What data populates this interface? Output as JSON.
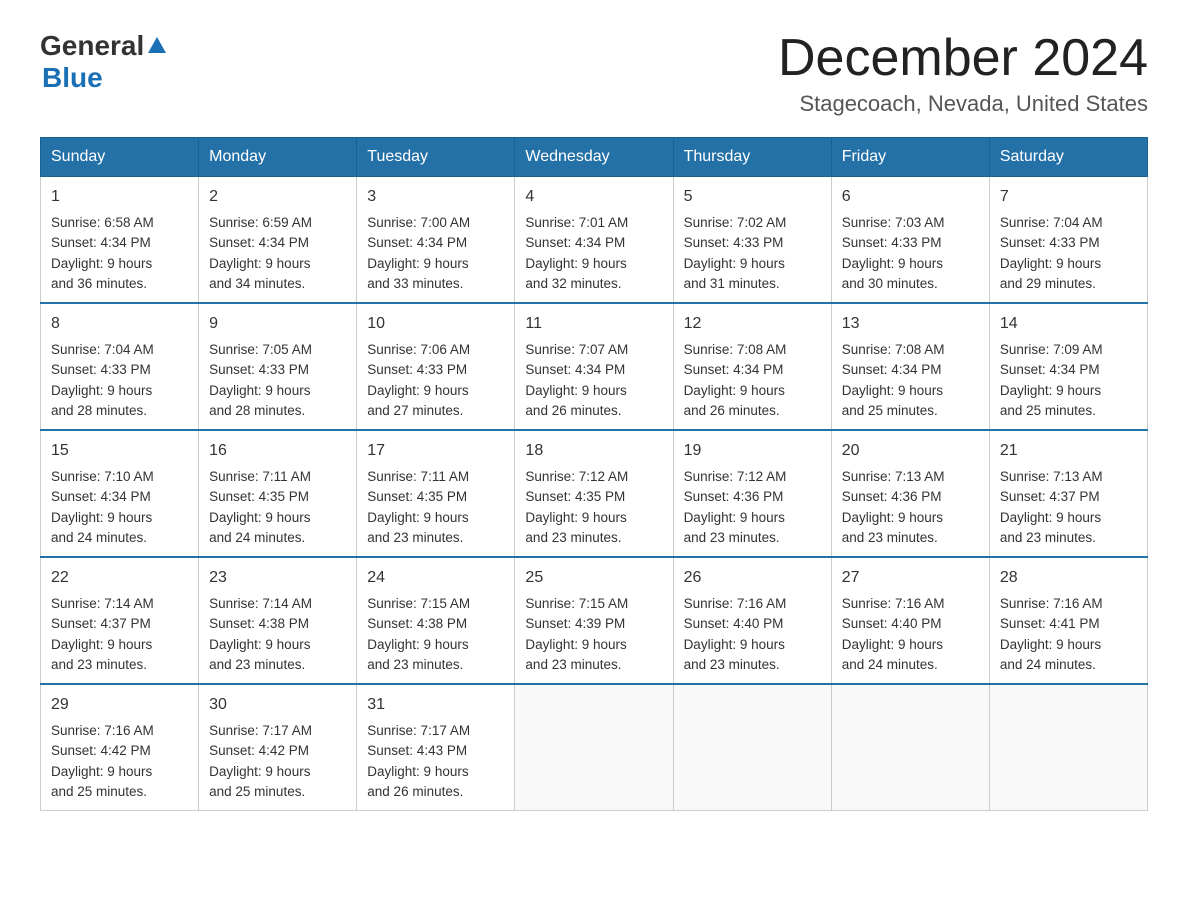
{
  "header": {
    "logo": {
      "line1": "General",
      "line2": "Blue"
    },
    "title": "December 2024",
    "location": "Stagecoach, Nevada, United States"
  },
  "weekdays": [
    "Sunday",
    "Monday",
    "Tuesday",
    "Wednesday",
    "Thursday",
    "Friday",
    "Saturday"
  ],
  "weeks": [
    [
      {
        "day": "1",
        "sunrise": "Sunrise: 6:58 AM",
        "sunset": "Sunset: 4:34 PM",
        "daylight": "Daylight: 9 hours",
        "daylight2": "and 36 minutes."
      },
      {
        "day": "2",
        "sunrise": "Sunrise: 6:59 AM",
        "sunset": "Sunset: 4:34 PM",
        "daylight": "Daylight: 9 hours",
        "daylight2": "and 34 minutes."
      },
      {
        "day": "3",
        "sunrise": "Sunrise: 7:00 AM",
        "sunset": "Sunset: 4:34 PM",
        "daylight": "Daylight: 9 hours",
        "daylight2": "and 33 minutes."
      },
      {
        "day": "4",
        "sunrise": "Sunrise: 7:01 AM",
        "sunset": "Sunset: 4:34 PM",
        "daylight": "Daylight: 9 hours",
        "daylight2": "and 32 minutes."
      },
      {
        "day": "5",
        "sunrise": "Sunrise: 7:02 AM",
        "sunset": "Sunset: 4:33 PM",
        "daylight": "Daylight: 9 hours",
        "daylight2": "and 31 minutes."
      },
      {
        "day": "6",
        "sunrise": "Sunrise: 7:03 AM",
        "sunset": "Sunset: 4:33 PM",
        "daylight": "Daylight: 9 hours",
        "daylight2": "and 30 minutes."
      },
      {
        "day": "7",
        "sunrise": "Sunrise: 7:04 AM",
        "sunset": "Sunset: 4:33 PM",
        "daylight": "Daylight: 9 hours",
        "daylight2": "and 29 minutes."
      }
    ],
    [
      {
        "day": "8",
        "sunrise": "Sunrise: 7:04 AM",
        "sunset": "Sunset: 4:33 PM",
        "daylight": "Daylight: 9 hours",
        "daylight2": "and 28 minutes."
      },
      {
        "day": "9",
        "sunrise": "Sunrise: 7:05 AM",
        "sunset": "Sunset: 4:33 PM",
        "daylight": "Daylight: 9 hours",
        "daylight2": "and 28 minutes."
      },
      {
        "day": "10",
        "sunrise": "Sunrise: 7:06 AM",
        "sunset": "Sunset: 4:33 PM",
        "daylight": "Daylight: 9 hours",
        "daylight2": "and 27 minutes."
      },
      {
        "day": "11",
        "sunrise": "Sunrise: 7:07 AM",
        "sunset": "Sunset: 4:34 PM",
        "daylight": "Daylight: 9 hours",
        "daylight2": "and 26 minutes."
      },
      {
        "day": "12",
        "sunrise": "Sunrise: 7:08 AM",
        "sunset": "Sunset: 4:34 PM",
        "daylight": "Daylight: 9 hours",
        "daylight2": "and 26 minutes."
      },
      {
        "day": "13",
        "sunrise": "Sunrise: 7:08 AM",
        "sunset": "Sunset: 4:34 PM",
        "daylight": "Daylight: 9 hours",
        "daylight2": "and 25 minutes."
      },
      {
        "day": "14",
        "sunrise": "Sunrise: 7:09 AM",
        "sunset": "Sunset: 4:34 PM",
        "daylight": "Daylight: 9 hours",
        "daylight2": "and 25 minutes."
      }
    ],
    [
      {
        "day": "15",
        "sunrise": "Sunrise: 7:10 AM",
        "sunset": "Sunset: 4:34 PM",
        "daylight": "Daylight: 9 hours",
        "daylight2": "and 24 minutes."
      },
      {
        "day": "16",
        "sunrise": "Sunrise: 7:11 AM",
        "sunset": "Sunset: 4:35 PM",
        "daylight": "Daylight: 9 hours",
        "daylight2": "and 24 minutes."
      },
      {
        "day": "17",
        "sunrise": "Sunrise: 7:11 AM",
        "sunset": "Sunset: 4:35 PM",
        "daylight": "Daylight: 9 hours",
        "daylight2": "and 23 minutes."
      },
      {
        "day": "18",
        "sunrise": "Sunrise: 7:12 AM",
        "sunset": "Sunset: 4:35 PM",
        "daylight": "Daylight: 9 hours",
        "daylight2": "and 23 minutes."
      },
      {
        "day": "19",
        "sunrise": "Sunrise: 7:12 AM",
        "sunset": "Sunset: 4:36 PM",
        "daylight": "Daylight: 9 hours",
        "daylight2": "and 23 minutes."
      },
      {
        "day": "20",
        "sunrise": "Sunrise: 7:13 AM",
        "sunset": "Sunset: 4:36 PM",
        "daylight": "Daylight: 9 hours",
        "daylight2": "and 23 minutes."
      },
      {
        "day": "21",
        "sunrise": "Sunrise: 7:13 AM",
        "sunset": "Sunset: 4:37 PM",
        "daylight": "Daylight: 9 hours",
        "daylight2": "and 23 minutes."
      }
    ],
    [
      {
        "day": "22",
        "sunrise": "Sunrise: 7:14 AM",
        "sunset": "Sunset: 4:37 PM",
        "daylight": "Daylight: 9 hours",
        "daylight2": "and 23 minutes."
      },
      {
        "day": "23",
        "sunrise": "Sunrise: 7:14 AM",
        "sunset": "Sunset: 4:38 PM",
        "daylight": "Daylight: 9 hours",
        "daylight2": "and 23 minutes."
      },
      {
        "day": "24",
        "sunrise": "Sunrise: 7:15 AM",
        "sunset": "Sunset: 4:38 PM",
        "daylight": "Daylight: 9 hours",
        "daylight2": "and 23 minutes."
      },
      {
        "day": "25",
        "sunrise": "Sunrise: 7:15 AM",
        "sunset": "Sunset: 4:39 PM",
        "daylight": "Daylight: 9 hours",
        "daylight2": "and 23 minutes."
      },
      {
        "day": "26",
        "sunrise": "Sunrise: 7:16 AM",
        "sunset": "Sunset: 4:40 PM",
        "daylight": "Daylight: 9 hours",
        "daylight2": "and 23 minutes."
      },
      {
        "day": "27",
        "sunrise": "Sunrise: 7:16 AM",
        "sunset": "Sunset: 4:40 PM",
        "daylight": "Daylight: 9 hours",
        "daylight2": "and 24 minutes."
      },
      {
        "day": "28",
        "sunrise": "Sunrise: 7:16 AM",
        "sunset": "Sunset: 4:41 PM",
        "daylight": "Daylight: 9 hours",
        "daylight2": "and 24 minutes."
      }
    ],
    [
      {
        "day": "29",
        "sunrise": "Sunrise: 7:16 AM",
        "sunset": "Sunset: 4:42 PM",
        "daylight": "Daylight: 9 hours",
        "daylight2": "and 25 minutes."
      },
      {
        "day": "30",
        "sunrise": "Sunrise: 7:17 AM",
        "sunset": "Sunset: 4:42 PM",
        "daylight": "Daylight: 9 hours",
        "daylight2": "and 25 minutes."
      },
      {
        "day": "31",
        "sunrise": "Sunrise: 7:17 AM",
        "sunset": "Sunset: 4:43 PM",
        "daylight": "Daylight: 9 hours",
        "daylight2": "and 26 minutes."
      },
      null,
      null,
      null,
      null
    ]
  ]
}
